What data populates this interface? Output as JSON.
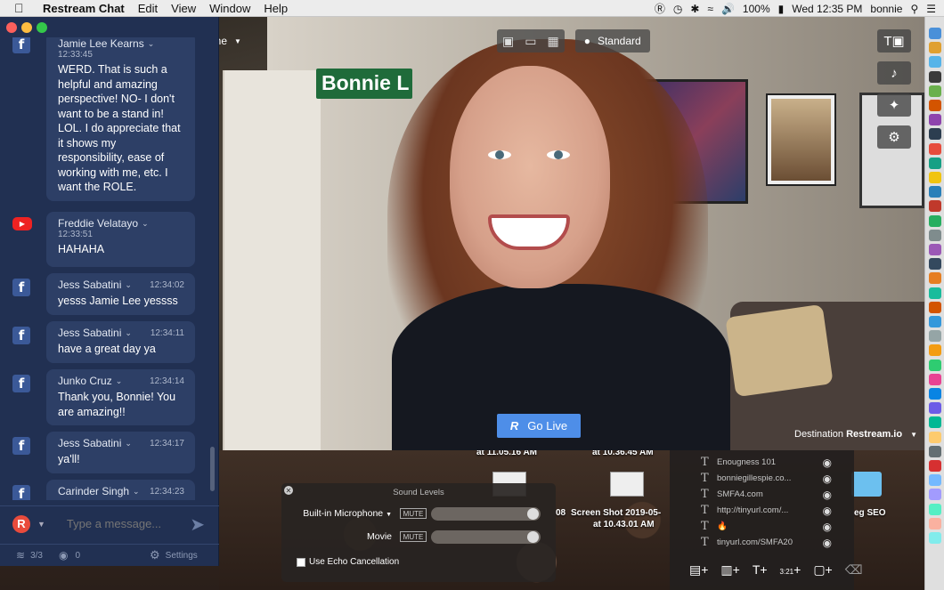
{
  "menubar": {
    "app_name": "Restream Chat",
    "items": [
      "Edit",
      "View",
      "Window",
      "Help"
    ],
    "battery": "100%",
    "clock": "Wed 12:35 PM",
    "user": "bonnie"
  },
  "video": {
    "scene_label": "..lt Scene",
    "mode_label": "Standard",
    "go_live_label": "Go Live",
    "destination_label": "Destination",
    "destination_value": "Restream.io",
    "sign_text": "Bonnie L"
  },
  "chat": {
    "messages": [
      {
        "platform": "facebook",
        "name": "Jamie Lee Kearns",
        "time": "12:33:45",
        "text": "WERD. That is such a helpful and amazing perspective! NO- I don't want to be a stand in! LOL. I do appreciate that it shows my responsibility, ease of working with me, etc. I want the ROLE."
      },
      {
        "platform": "youtube",
        "name": "Freddie Velatayo",
        "time": "12:33:51",
        "text": "HAHAHA"
      },
      {
        "platform": "facebook",
        "name": "Jess Sabatini",
        "time": "12:34:02",
        "text": "yesss Jamie Lee yessss"
      },
      {
        "platform": "facebook",
        "name": "Jess Sabatini",
        "time": "12:34:11",
        "text": "have a great day ya"
      },
      {
        "platform": "facebook",
        "name": "Junko Cruz",
        "time": "12:34:14",
        "text": "Thank you, Bonnie! You are amazing!!"
      },
      {
        "platform": "facebook",
        "name": "Jess Sabatini",
        "time": "12:34:17",
        "text": "ya'll!"
      },
      {
        "platform": "facebook",
        "name": "Carinder Singh",
        "time": "12:34:23",
        "text": ""
      }
    ],
    "input_placeholder": "Type a message...",
    "connections": "3/3",
    "viewers": "0",
    "settings_label": "Settings"
  },
  "sound_levels": {
    "title": "Sound Levels",
    "mic_label": "Built-in Microphone",
    "movie_label": "Movie",
    "mute_label": "MUTE",
    "echo_label": "Use Echo Cancellation"
  },
  "overlays": {
    "items": [
      "Enougness 101",
      "bonniegillespie.co...",
      "SMFA4.com",
      "http://tinyurl.com/...",
      "🔥",
      "tinyurl.com/SMFA20"
    ],
    "clock_tool": "3:21"
  },
  "desktop": {
    "labels": [
      "at 11.05.16 AM",
      "at 10.36.45 AM",
      "08",
      "Screen Shot 2019-05-",
      "at 10.43.01 AM",
      "eg SEO"
    ]
  }
}
